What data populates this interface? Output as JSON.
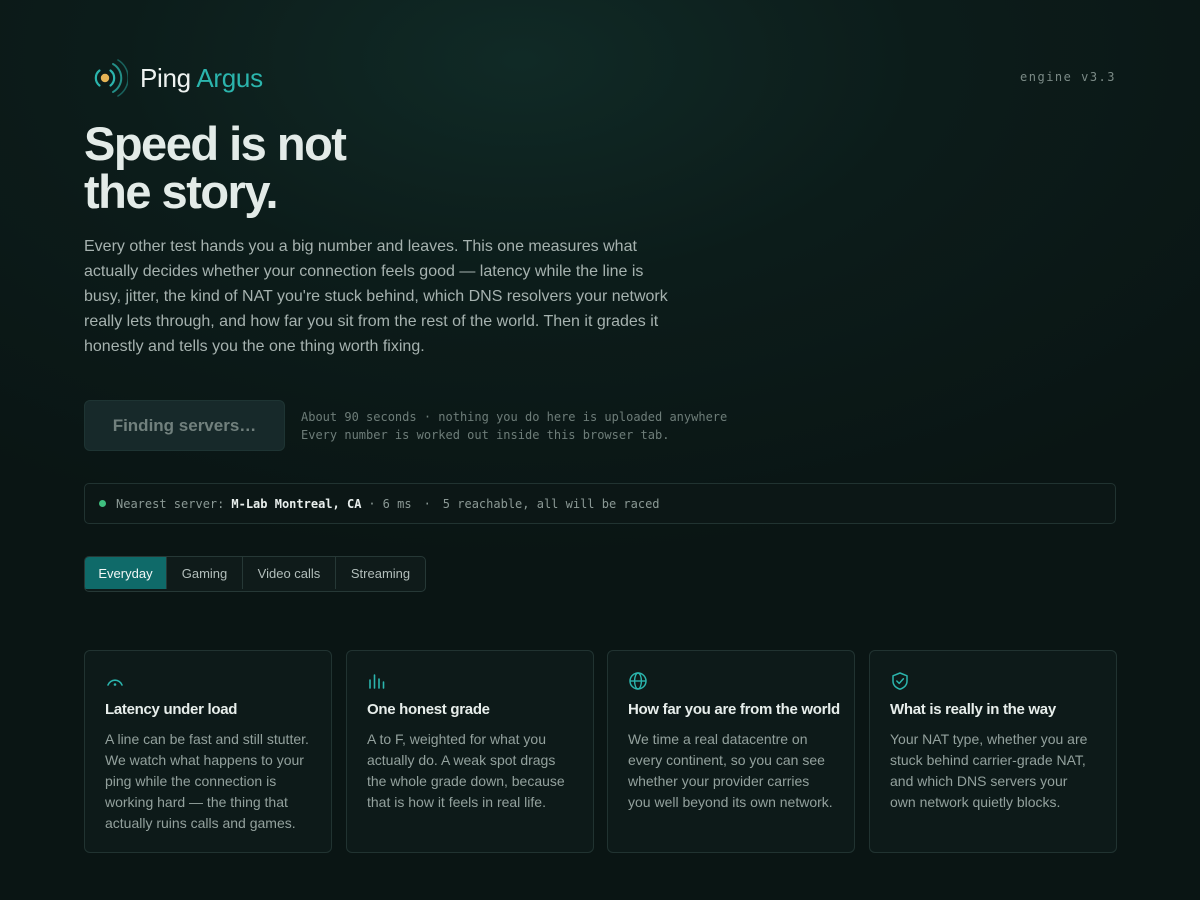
{
  "header": {
    "brand_name": "Ping",
    "brand_accent": "Argus",
    "version": "engine v3.3",
    "logo_icon": "radar-signal-icon"
  },
  "hero": {
    "title_line1": "Speed is not",
    "title_line2": "the story.",
    "description": "Every other test hands you a big number and leaves. This one measures what actually decides whether your connection feels good — latency while the line is busy, jitter, the kind of NAT you're stuck behind, which DNS resolvers your network really lets through, and how far you sit from the rest of the world. Then it grades it honestly and tells you the one thing worth fixing."
  },
  "start": {
    "button_label": "Finding servers…",
    "note_line1": "About 90 seconds · nothing you do here is uploaded anywhere",
    "note_line2": "Every number is worked out inside this browser tab."
  },
  "server": {
    "prefix": "Nearest server:",
    "name": "M-Lab Montreal, CA",
    "separator": "·",
    "ping": "6 ms",
    "dot_separator": "·",
    "reachable": "5 reachable, all will be raced",
    "status_color": "#3fbf7f"
  },
  "tabs": [
    {
      "label": "Everyday",
      "active": true
    },
    {
      "label": "Gaming",
      "active": false
    },
    {
      "label": "Video calls",
      "active": false
    },
    {
      "label": "Streaming",
      "active": false
    }
  ],
  "cards": [
    {
      "icon": "gauge-icon",
      "title": "Latency under load",
      "text": "A line can be fast and still stutter. We watch what happens to your ping while the connection is working hard — the thing that actually ruins calls and games."
    },
    {
      "icon": "bar-chart-icon",
      "title": "One honest grade",
      "text": "A to F, weighted for what you actually do. A weak spot drags the whole grade down, because that is how it feels in real life."
    },
    {
      "icon": "globe-icon",
      "title": "How far you are from the world",
      "text": "We time a real datacentre on every continent, so you can see whether your provider carries you well beyond its own network."
    },
    {
      "icon": "shield-check-icon",
      "title": "What is really in the way",
      "text": "Your NAT type, whether you are stuck behind carrier-grade NAT, and which DNS servers your own network quietly blocks."
    }
  ],
  "colors": {
    "accent": "#2bb5ad",
    "active_tab": "#0f6a69",
    "logo_dot": "#e6b455",
    "background": "#0b1716"
  }
}
